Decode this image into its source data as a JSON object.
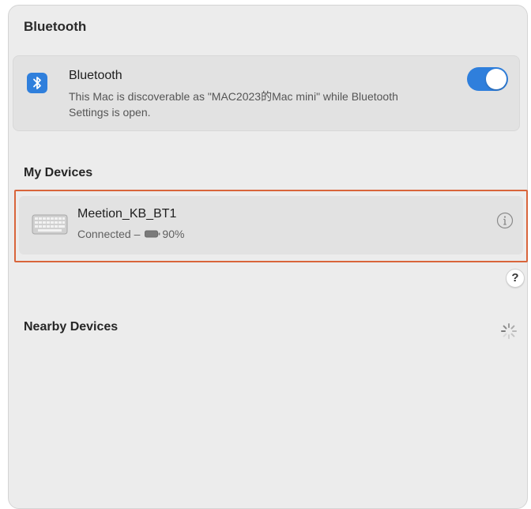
{
  "window": {
    "title": "Bluetooth"
  },
  "bluetooth_card": {
    "icon": "bluetooth-icon",
    "name": "Bluetooth",
    "description": "This Mac is discoverable as \"MAC2023的Mac mini\" while Bluetooth Settings is open.",
    "toggle_on": true,
    "accent_color": "#2f7fdc"
  },
  "my_devices": {
    "title": "My Devices",
    "devices": [
      {
        "icon": "keyboard-icon",
        "name": "Meetion_KB_BT1",
        "status": "Connected –",
        "battery_icon": "battery-icon",
        "battery": "90%",
        "info_icon": "info-icon"
      }
    ],
    "highlight_color": "#d9653b"
  },
  "help": {
    "label": "?"
  },
  "nearby_devices": {
    "title": "Nearby Devices",
    "loading_icon": "spinner-icon"
  }
}
